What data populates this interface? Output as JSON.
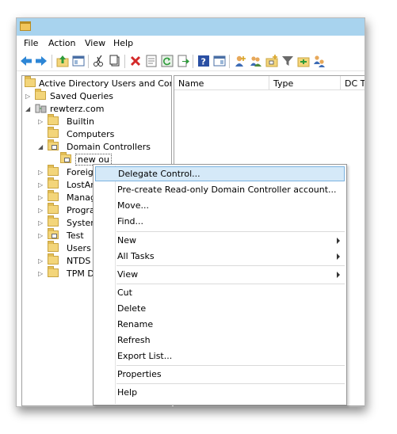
{
  "menubar": {
    "items": [
      "File",
      "Action",
      "View",
      "Help"
    ]
  },
  "tree": {
    "items": [
      {
        "label": "Active Directory Users and Comput",
        "level": 0,
        "twisty": ""
      },
      {
        "label": "Saved Queries",
        "level": 1,
        "twisty": "collapsed"
      },
      {
        "label": "rewterz.com",
        "level": 1,
        "twisty": "expanded"
      },
      {
        "label": "Builtin",
        "level": 2,
        "twisty": "collapsed"
      },
      {
        "label": "Computers",
        "level": 2,
        "twisty": ""
      },
      {
        "label": "Domain Controllers",
        "level": 2,
        "twisty": "expanded"
      },
      {
        "label": "new ou",
        "level": 3,
        "twisty": "",
        "selected": true
      },
      {
        "label": "Foreign",
        "level": 2,
        "twisty": "collapsed"
      },
      {
        "label": "LostAnd",
        "level": 2,
        "twisty": "collapsed"
      },
      {
        "label": "Manage",
        "level": 2,
        "twisty": "collapsed"
      },
      {
        "label": "Program",
        "level": 2,
        "twisty": "collapsed"
      },
      {
        "label": "System",
        "level": 2,
        "twisty": "collapsed"
      },
      {
        "label": "Test",
        "level": 2,
        "twisty": "collapsed"
      },
      {
        "label": "Users",
        "level": 2,
        "twisty": ""
      },
      {
        "label": "NTDS Q",
        "level": 2,
        "twisty": "collapsed"
      },
      {
        "label": "TPM De",
        "level": 2,
        "twisty": "collapsed"
      }
    ]
  },
  "list": {
    "columns": [
      "Name",
      "Type",
      "DC T"
    ]
  },
  "context_menu": {
    "items": [
      {
        "label": "Delegate Control...",
        "highlighted": true
      },
      {
        "label": "Pre-create Read-only Domain Controller account..."
      },
      {
        "label": "Move..."
      },
      {
        "label": "Find..."
      },
      {
        "separator": true
      },
      {
        "label": "New",
        "submenu": true
      },
      {
        "label": "All Tasks",
        "submenu": true
      },
      {
        "separator": true
      },
      {
        "label": "View",
        "submenu": true
      },
      {
        "separator": true
      },
      {
        "label": "Cut"
      },
      {
        "label": "Delete"
      },
      {
        "label": "Rename"
      },
      {
        "label": "Refresh"
      },
      {
        "label": "Export List..."
      },
      {
        "separator": true
      },
      {
        "label": "Properties"
      },
      {
        "separator": true
      },
      {
        "label": "Help"
      }
    ]
  },
  "toolbar": {
    "icons": [
      "back-arrow-icon",
      "forward-arrow-icon",
      "up-folder-icon",
      "show-hide-tree-icon",
      "cut-icon",
      "copy-icon",
      "delete-icon",
      "properties-icon",
      "refresh-icon",
      "export-list-icon",
      "help-icon",
      "console-icon",
      "new-user-icon",
      "new-group-icon",
      "new-ou-icon",
      "filter-icon",
      "add-to-group-icon",
      "delegate-users-icon"
    ]
  },
  "colors": {
    "title_bar": "#a8d3ee",
    "menu_highlight": "#d5e9f8",
    "menu_highlight_border": "#7bb3e0",
    "folder": "#f3d57a"
  }
}
